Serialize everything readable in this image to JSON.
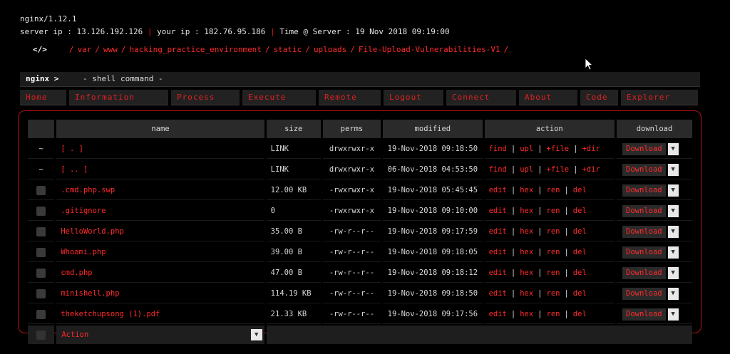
{
  "header": {
    "server": "nginx/1.12.1",
    "server_ip_label": "server ip : 13.126.192.126",
    "your_ip_label": "your ip : 182.76.95.186",
    "time_label": "Time @ Server : 19 Nov 2018 09:19:00",
    "separator": "|",
    "code_icon": "</>",
    "path": [
      "var",
      "www",
      "hacking_practice_environment",
      "static",
      "uploads",
      "File-Upload-Vulnerabilities-V1"
    ],
    "path_sep": "/"
  },
  "cmdbar": {
    "prompt": "nginx >",
    "placeholder": "- shell command -"
  },
  "menu": [
    "Home",
    "Information",
    "Process",
    "Execute",
    "Remote",
    "Logout",
    "Connect",
    "About",
    "Code",
    "Explorer"
  ],
  "table": {
    "columns": [
      "name",
      "size",
      "perms",
      "modified",
      "action",
      "download"
    ],
    "rows": [
      {
        "sel": "~",
        "name": "[ . ]",
        "size": "LINK",
        "perms": "drwxrwxr-x",
        "modified": "19-Nov-2018 09:18:50",
        "actions": [
          "find",
          "upl",
          "+file",
          "+dir"
        ]
      },
      {
        "sel": "~",
        "name": "[ .. ]",
        "size": "LINK",
        "perms": "drwxrwxr-x",
        "modified": "06-Nov-2018 04:53:50",
        "actions": [
          "find",
          "upl",
          "+file",
          "+dir"
        ]
      },
      {
        "sel": "",
        "name": ".cmd.php.swp",
        "size": "12.00 KB",
        "perms": "-rwxrwxr-x",
        "modified": "19-Nov-2018 05:45:45",
        "actions": [
          "edit",
          "hex",
          "ren",
          "del"
        ]
      },
      {
        "sel": "",
        "name": ".gitignore",
        "size": "0",
        "perms": "-rwxrwxr-x",
        "modified": "19-Nov-2018 09:10:00",
        "actions": [
          "edit",
          "hex",
          "ren",
          "del"
        ]
      },
      {
        "sel": "",
        "name": "HelloWorld.php",
        "size": "35.00 B",
        "perms": "-rw-r--r--",
        "modified": "19-Nov-2018 09:17:59",
        "actions": [
          "edit",
          "hex",
          "ren",
          "del"
        ]
      },
      {
        "sel": "",
        "name": "Whoami.php",
        "size": "39.00 B",
        "perms": "-rw-r--r--",
        "modified": "19-Nov-2018 09:18:05",
        "actions": [
          "edit",
          "hex",
          "ren",
          "del"
        ]
      },
      {
        "sel": "",
        "name": "cmd.php",
        "size": "47.00 B",
        "perms": "-rw-r--r--",
        "modified": "19-Nov-2018 09:18:12",
        "actions": [
          "edit",
          "hex",
          "ren",
          "del"
        ]
      },
      {
        "sel": "",
        "name": "minishell.php",
        "size": "114.19 KB",
        "perms": "-rw-r--r--",
        "modified": "19-Nov-2018 09:18:50",
        "actions": [
          "edit",
          "hex",
          "ren",
          "del"
        ]
      },
      {
        "sel": "",
        "name": "theketchupsong (1).pdf",
        "size": "21.33 KB",
        "perms": "-rw-r--r--",
        "modified": "19-Nov-2018 09:17:56",
        "actions": [
          "edit",
          "hex",
          "ren",
          "del"
        ]
      }
    ],
    "download_label": "Download",
    "footer_action": "Action"
  },
  "icons": {
    "caret": "chevron-down-icon",
    "checkbox": "checkbox-icon",
    "cursor": "mouse-pointer-icon"
  }
}
